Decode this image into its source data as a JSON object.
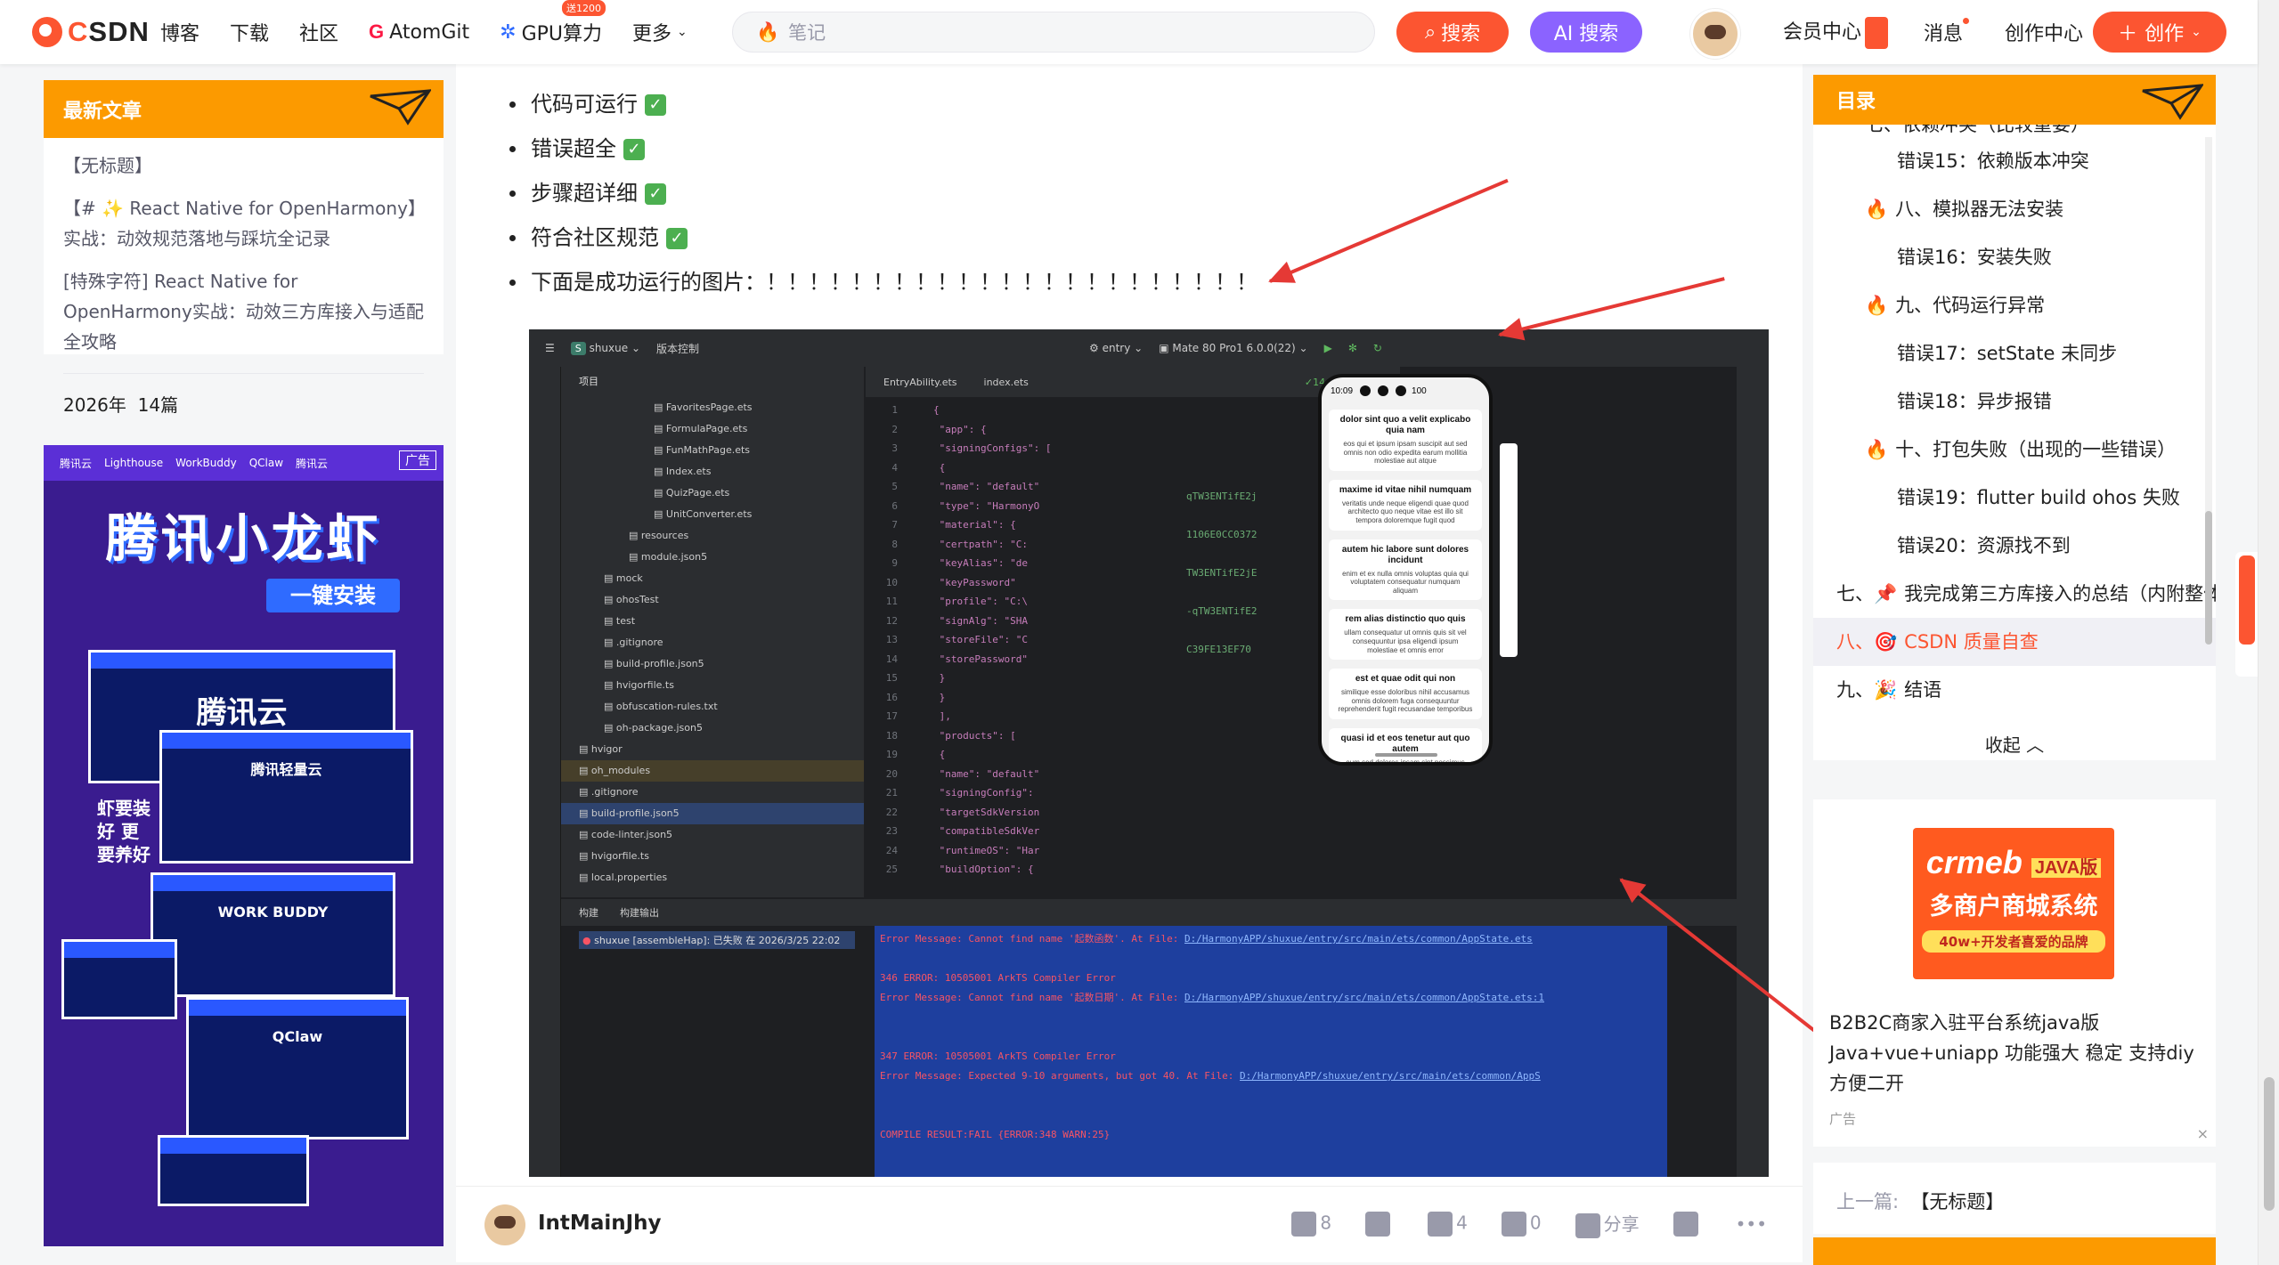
{
  "topbar": {
    "logo_prefix": "C",
    "logo_rest": "SDN",
    "nav": [
      "博客",
      "下载",
      "社区"
    ],
    "atomgit_g": "G",
    "atomgit_label": "AtomGit",
    "gpu_label": "GPU算力",
    "gpu_badge": "送1200",
    "more_label": "更多",
    "search_placeholder": "笔记",
    "search_button": "搜索",
    "ai_search_button": "AI 搜索",
    "vip_label": "会员中心",
    "messages_label": "消息",
    "creator_center_label": "创作中心",
    "create_button": "创作"
  },
  "left": {
    "latest_title": "最新文章",
    "articles": [
      "【无标题】",
      "【# ✨ React Native for OpenHarmony】实战：动效规范落地与踩坑全记录",
      "[特殊字符] React Native for OpenHarmony实战：动效三方库接入与适配全攻略"
    ],
    "stats_year": "2026年",
    "stats_count": "14篇",
    "ad": {
      "brands": [
        "腾讯云",
        "Lighthouse",
        "WorkBuddy",
        "QClaw",
        "腾讯云"
      ],
      "tag": "广告",
      "title": "腾讯小龙虾",
      "subtitle": "一键安装",
      "side_text": "虾要装好 更要养好",
      "cloud_name": "腾讯云",
      "win1_title": "腾讯轻量云",
      "win2_title": "WORK BUDDY",
      "win3_title": "QClaw"
    }
  },
  "main": {
    "bullets": [
      {
        "text": "代码可运行",
        "check": true
      },
      {
        "text": "错误超全",
        "check": true
      },
      {
        "text": "步骤超详细",
        "check": true
      },
      {
        "text": "符合社区规范",
        "check": true
      },
      {
        "text": "下面是成功运行的图片：！！！！！！！！！！！！！！！！！！！！！！！",
        "check": false
      }
    ],
    "check_glyph": "✓",
    "ide": {
      "project_badge": "S",
      "project_name": "shuxue",
      "vcs_label": "版本控制",
      "run_config": "entry",
      "device": "Mate 80 Pro1 6.0.0(22)",
      "tree_header": "项目",
      "tree_rows": [
        {
          "name": "FavoritesPage.ets",
          "indent": 6
        },
        {
          "name": "FormulaPage.ets",
          "indent": 6
        },
        {
          "name": "FunMathPage.ets",
          "indent": 6
        },
        {
          "name": "Index.ets",
          "indent": 6
        },
        {
          "name": "QuizPage.ets",
          "indent": 6
        },
        {
          "name": "UnitConverter.ets",
          "indent": 6
        },
        {
          "name": "resources",
          "indent": 4
        },
        {
          "name": "module.json5",
          "indent": 4
        },
        {
          "name": "mock",
          "indent": 2
        },
        {
          "name": "ohosTest",
          "indent": 2
        },
        {
          "name": "test",
          "indent": 2
        },
        {
          "name": ".gitignore",
          "indent": 2
        },
        {
          "name": "build-profile.json5",
          "indent": 2
        },
        {
          "name": "hvigorfile.ts",
          "indent": 2
        },
        {
          "name": "obfuscation-rules.txt",
          "indent": 2
        },
        {
          "name": "oh-package.json5",
          "indent": 2
        },
        {
          "name": "hvigor",
          "indent": 0
        },
        {
          "name": "oh_modules",
          "indent": 0
        },
        {
          "name": ".gitignore",
          "indent": 0
        },
        {
          "name": "build-profile.json5",
          "indent": 0
        },
        {
          "name": "code-linter.json5",
          "indent": 0
        },
        {
          "name": "hvigorfile.ts",
          "indent": 0
        },
        {
          "name": "local.properties",
          "indent": 0
        }
      ],
      "editor_tabs": [
        "EntryAbility.ets",
        "index.ets"
      ],
      "warnings": "✓14",
      "code_lines": [
        {
          "n": "1",
          "t": "{"
        },
        {
          "n": "2",
          "t": "  \"app\": {"
        },
        {
          "n": "3",
          "t": "    \"signingConfigs\": ["
        },
        {
          "n": "4",
          "t": "      {"
        },
        {
          "n": "5",
          "t": "        \"name\": \"default\""
        },
        {
          "n": "6",
          "t": "        \"type\": \"HarmonyO"
        },
        {
          "n": "7",
          "t": "        \"material\": {"
        },
        {
          "n": "8",
          "t": "          \"certpath\": \"C:"
        },
        {
          "n": "9",
          "t": "          \"keyAlias\": \"de"
        },
        {
          "n": "10",
          "t": "          \"keyPassword\""
        },
        {
          "n": "11",
          "t": "          \"profile\": \"C:\\"
        },
        {
          "n": "12",
          "t": "          \"signAlg\": \"SHA"
        },
        {
          "n": "13",
          "t": "          \"storeFile\": \"C"
        },
        {
          "n": "14",
          "t": "          \"storePassword\""
        },
        {
          "n": "15",
          "t": "        }"
        },
        {
          "n": "16",
          "t": "      }"
        },
        {
          "n": "17",
          "t": "    ],"
        },
        {
          "n": "18",
          "t": "    \"products\": ["
        },
        {
          "n": "19",
          "t": "      {"
        },
        {
          "n": "20",
          "t": "        \"name\": \"default\""
        },
        {
          "n": "21",
          "t": "        \"signingConfig\":"
        },
        {
          "n": "22",
          "t": "        \"targetSdkVersion"
        },
        {
          "n": "23",
          "t": "        \"compatibleSdkVer"
        },
        {
          "n": "24",
          "t": "        \"runtimeOS\": \"Har"
        },
        {
          "n": "25",
          "t": "        \"buildOption\": {"
        }
      ],
      "code_tail": [
        "qTW3ENTifE2j",
        "1106E0CC0372",
        "TW3ENTifE2jE",
        "-qTW3ENTifE2",
        "C39FE13EF70"
      ],
      "build_tabs": [
        "构建",
        "构建输出"
      ],
      "build_item": "shuxue [assembleHap]: 已失败 在 2026/3/25 22:02",
      "log": [
        {
          "type": "msg",
          "text": "Error Message: Cannot find name '起数函数'. At File: ",
          "link": "D:/HarmonyAPP/shuxue/entry/src/main/ets/common/AppState.ets"
        },
        {
          "type": "blank"
        },
        {
          "type": "err",
          "text": "346 ERROR: 10505001 ArkTS Compiler Error"
        },
        {
          "type": "msg",
          "text": "Error Message: Cannot find name '起数日期'. At File: ",
          "link": "D:/HarmonyAPP/shuxue/entry/src/main/ets/common/AppState.ets:1"
        },
        {
          "type": "blank"
        },
        {
          "type": "blank"
        },
        {
          "type": "err",
          "text": "347 ERROR: 10505001 ArkTS Compiler Error"
        },
        {
          "type": "msg",
          "text": "Error Message: Expected 9-10 arguments, but got 40. At File: ",
          "link": "D:/HarmonyAPP/shuxue/entry/src/main/ets/common/AppS"
        },
        {
          "type": "blank"
        },
        {
          "type": "blank"
        },
        {
          "type": "err",
          "text": "COMPILE RESULT:FAIL {ERROR:348 WARN:25}"
        }
      ],
      "phone": {
        "time": "10:09",
        "battery": "100",
        "cards": [
          {
            "title": "dolor sint quo a velit explicabo quia nam",
            "body": "eos qui et ipsum ipsam suscipit aut sed omnis non odio expedita earum mollitia molestiae aut atque"
          },
          {
            "title": "maxime id vitae nihil numquam",
            "body": "veritatis unde neque eligendi quae quod architecto quo neque vitae est illo sit tempora doloremque fugit quod"
          },
          {
            "title": "autem hic labore sunt dolores incidunt",
            "body": "enim et ex nulla omnis voluptas quia qui voluptatem consequatur numquam aliquam"
          },
          {
            "title": "rem alias distinctio quo quis",
            "body": "ullam consequatur ut omnis quis sit vel consequuntur ipsa eligendi ipsum molestiae et omnis error"
          },
          {
            "title": "est et quae odit qui non",
            "body": "similique esse doloribus nihil accusamus omnis dolorem fuga consequuntur reprehenderit fugit recusandae temporibus"
          },
          {
            "title": "quasi id et eos tenetur aut quo autem",
            "body": "eum sed dolores ipsam sint possimus debitis occaecati debitis qui qui et"
          }
        ]
      }
    }
  },
  "author": {
    "name": "IntMainJhy",
    "likes": "8",
    "favorites": "4",
    "comments": "0",
    "share": "分享",
    "more": "•••"
  },
  "toc": {
    "title": "目录",
    "top_partial": "七、依赖冲突（比较重要）",
    "items": [
      {
        "level": 2,
        "text": "错误15：依赖版本冲突"
      },
      {
        "level": 1,
        "prefix": "八、",
        "text": "模拟器无法安装",
        "fire": true
      },
      {
        "level": 2,
        "text": "错误16：安装失败"
      },
      {
        "level": 1,
        "prefix": "九、",
        "text": "代码运行异常",
        "fire": true
      },
      {
        "level": 2,
        "text": "错误17：setState 未同步"
      },
      {
        "level": 2,
        "text": "错误18：异步报错"
      },
      {
        "level": 1,
        "prefix": "十、",
        "text": "打包失败（出现的一些错误）",
        "fire": true
      },
      {
        "level": 2,
        "text": "错误19：flutter build ohos 失败"
      },
      {
        "level": 2,
        "text": "错误20：资源找不到"
      },
      {
        "level": 0,
        "prefix": "七、",
        "text": "我完成第三方库接入的总结（内附整体）",
        "icon": "📌"
      },
      {
        "level": 0,
        "prefix": "八、",
        "text": "CSDN 质量自查",
        "icon": "🎯",
        "active": true
      },
      {
        "level": 0,
        "prefix": "九、",
        "text": "结语",
        "icon": "🎉"
      }
    ],
    "fold": "收起"
  },
  "right_ad": {
    "img_brand": "crmeb",
    "img_edition": "JAVA版",
    "img_title": "多商户商城系统",
    "img_slogan": "40w+开发者喜爱的品牌",
    "text": "B2B2C商家入驻平台系统java版 Java+vue+uniapp 功能强大 稳定 支持diy 方便二开",
    "tag": "广告",
    "close": "×"
  },
  "prev": {
    "label": "上一篇:",
    "title": "【无标题】"
  },
  "colors": {
    "brand": "#fc5531",
    "orange": "#fc9a00",
    "ai": "#8b63ff",
    "annotation_arrow": "#e53935"
  }
}
